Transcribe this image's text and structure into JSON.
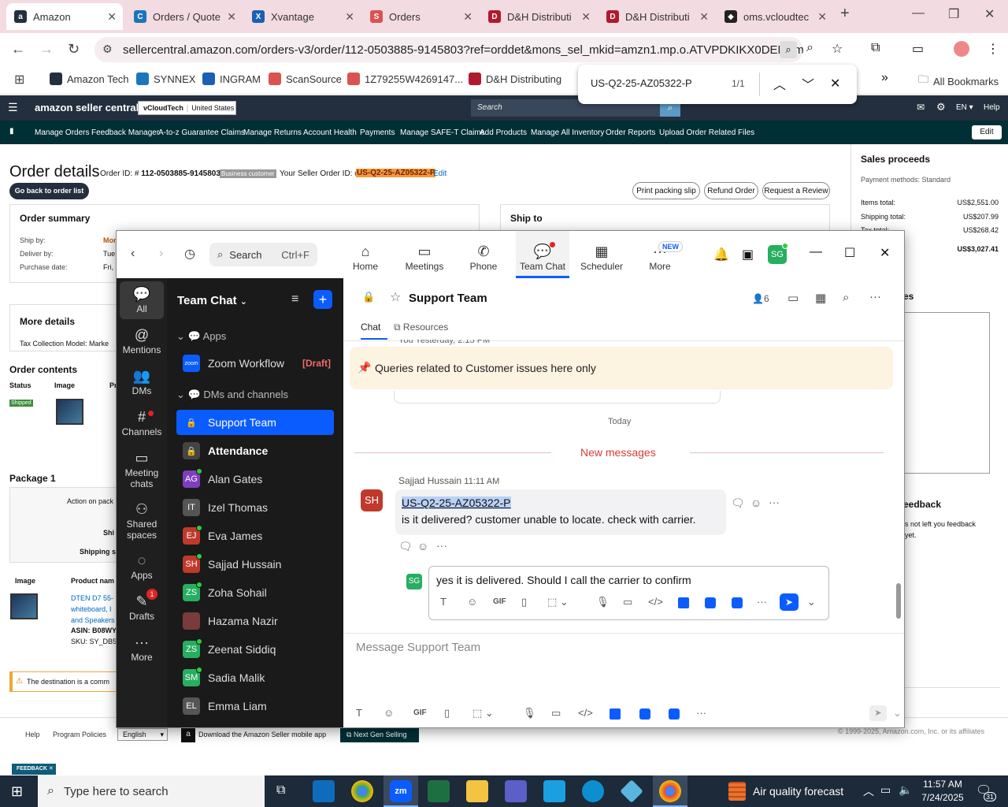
{
  "browser": {
    "tabs": [
      {
        "label": "Amazon",
        "fav": "a",
        "color": "#232f3e"
      },
      {
        "label": "Orders / Quote",
        "fav": "C",
        "color": "#1b75bb"
      },
      {
        "label": "Xvantage",
        "fav": "X",
        "color": "#1a5fb4"
      },
      {
        "label": "Orders",
        "fav": "S",
        "color": "#d9534f"
      },
      {
        "label": "D&H Distributi",
        "fav": "D",
        "color": "#b01a2e"
      },
      {
        "label": "D&H Distributi",
        "fav": "D",
        "color": "#b01a2e"
      },
      {
        "label": "oms.vcloudtec",
        "fav": "◆",
        "color": "#222"
      }
    ],
    "url": "sellercentral.amazon.com/orders-v3/order/112-0503885-9145803?ref=orddet&mons_sel_mkid=amzn1.mp.o.ATVPDKIKX0DER&mo...",
    "bookmarks": [
      "Amazon Tech",
      "SYNNEX",
      "INGRAM",
      "ScanSource",
      "1Z79255W4269147...",
      "D&H Distributing"
    ],
    "all_bookmarks": "All Bookmarks",
    "find": {
      "query": "US-Q2-25-AZ05322-P",
      "count": "1/1"
    }
  },
  "seller": {
    "logo": "amazon seller central",
    "store": "vCloudTech",
    "region": "United States",
    "search_placeholder": "Search",
    "lang": "EN",
    "help": "Help",
    "nav": [
      "Manage Orders",
      "Feedback Manager",
      "A-to-z Guarantee Claims",
      "Manage Returns",
      "Account Health",
      "Payments",
      "Manage SAFE-T Claims",
      "Add Products",
      "Manage All Inventory",
      "Order Reports",
      "Upload Order Related Files"
    ],
    "edit": "Edit"
  },
  "order": {
    "title": "Order details",
    "order_id_label": "Order ID: #",
    "order_id": "112-0503885-9145803",
    "business": "Business customer",
    "seller_order_label": "Your Seller Order ID: #",
    "seller_order_id": "US-Q2-25-AZ05322-P",
    "edit": "Edit",
    "back": "Go back to order list",
    "buttons": [
      "Print packing slip",
      "Refund Order",
      "Request a Review"
    ],
    "summary_title": "Order summary",
    "ship_by": "Ship by:",
    "deliver_by": "Deliver by:",
    "purchase_date": "Purchase date:",
    "ship_by_v": "Mon",
    "deliver_by_v": "Tue,",
    "purchase_v": "Fri,",
    "ship_to": "Ship to",
    "more_details": "More details",
    "tax_model": "Tax Collection Model: Marke",
    "contents": "Order contents",
    "col_status": "Status",
    "col_image": "Image",
    "col_pr": "Pr",
    "shipped": "Shipped",
    "package": "Package 1",
    "action": "Action on pack",
    "ship": "Shi",
    "shipping": "Shipping s",
    "img_col": "Image",
    "prod_col": "Product nam",
    "prod_lines": [
      "DTEN D7 55-",
      "whiteboard, I",
      "and Speakers"
    ],
    "asin": "ASIN: B08WY",
    "sku": "SKU: SY_DB5",
    "dest": "The destination is a comm",
    "sales_title": "Sales proceeds",
    "pay_methods": "Payment methods: Standard",
    "items_total": "Items total:",
    "items_total_v": "US$2,551.00",
    "shipping_total": "Shipping total:",
    "shipping_total_v": "US$207.99",
    "tax_total": "Tax total:",
    "tax_total_v": "US$268.42",
    "grand_v": "US$3,027.41",
    "es": "es",
    "feedback": "eedback",
    "fb_line1": "s not left you feedback",
    "fb_line2": "yet."
  },
  "footer": {
    "help": "Help",
    "policies": "Program Policies",
    "lang": "English",
    "mobile": "Download the Amazon Seller mobile app",
    "nextgen": "Next Gen Selling",
    "copyright": "© 1999-2025, Amazon.com, Inc. or its affiliates",
    "feedback": "FEEDBACK"
  },
  "zoom": {
    "search": "Search",
    "shortcut": "Ctrl+F",
    "top": [
      {
        "label": "Home",
        "icon": "⌂"
      },
      {
        "label": "Meetings",
        "icon": "▭"
      },
      {
        "label": "Phone",
        "icon": "✆"
      },
      {
        "label": "Team Chat",
        "icon": "💬"
      },
      {
        "label": "Scheduler",
        "icon": "▦"
      },
      {
        "label": "More",
        "icon": "···"
      }
    ],
    "new_badge": "NEW",
    "avatar": "SG",
    "side": [
      {
        "label": "All",
        "icon": "💬"
      },
      {
        "label": "Mentions",
        "icon": "@"
      },
      {
        "label": "DMs",
        "icon": "👥"
      },
      {
        "label": "Channels",
        "icon": "#"
      },
      {
        "label": "Meeting chats",
        "icon": "▭"
      },
      {
        "label": "Shared spaces",
        "icon": "⚇"
      },
      {
        "label": "Apps",
        "icon": "◌"
      },
      {
        "label": "Drafts",
        "icon": "✎"
      },
      {
        "label": "More",
        "icon": "···"
      }
    ],
    "drafts_badge": "1",
    "list_title": "Team Chat",
    "apps": "Apps",
    "zoom_workflow": "Zoom Workflow",
    "draft": "[Draft]",
    "dms": "DMs and channels",
    "contacts": [
      {
        "name": "Support Team",
        "init": "",
        "color": "#3b82f6"
      },
      {
        "name": "Attendance",
        "init": "",
        "color": "#444"
      },
      {
        "name": "Alan Gates",
        "init": "AG",
        "color": "#7e3fbf"
      },
      {
        "name": "Izel Thomas",
        "init": "IT",
        "color": "#555"
      },
      {
        "name": "Eva James",
        "init": "EJ",
        "color": "#c0392b"
      },
      {
        "name": "Sajjad Hussain",
        "init": "SH",
        "color": "#c0392b"
      },
      {
        "name": "Zoha Sohail",
        "init": "ZS",
        "color": "#27ae60"
      },
      {
        "name": "Hazama Nazir",
        "init": "",
        "color": "#7a3b3b"
      },
      {
        "name": "Zeenat Siddiq",
        "init": "ZS",
        "color": "#27ae60"
      },
      {
        "name": "Sadia Malik",
        "init": "SM",
        "color": "#27ae60"
      },
      {
        "name": "Emma Liam",
        "init": "EL",
        "color": "#555"
      }
    ],
    "channel": "Support Team",
    "members": "6",
    "tab_chat": "Chat",
    "tab_resources": "Resources",
    "prev_time": "You Yesterday, 2:15 PM",
    "pinned": "Queries related to Customer issues here only",
    "today": "Today",
    "new_messages": "New messages",
    "msg_sender": "Sajjad Hussain",
    "msg_time": "11:11 AM",
    "msg_line1": "US-Q2-25-AZ05322-P",
    "msg_line2": "is it delivered? customer unable to locate. check with carrier.",
    "reply_text": "yes it is delivered. Should I call the carrier to confirm",
    "compose_placeholder": "Message Support Team"
  },
  "taskbar": {
    "search": "Type here to search",
    "weather": "Air quality forecast",
    "time": "11:57 AM",
    "date": "7/24/2025",
    "notif": "31"
  }
}
